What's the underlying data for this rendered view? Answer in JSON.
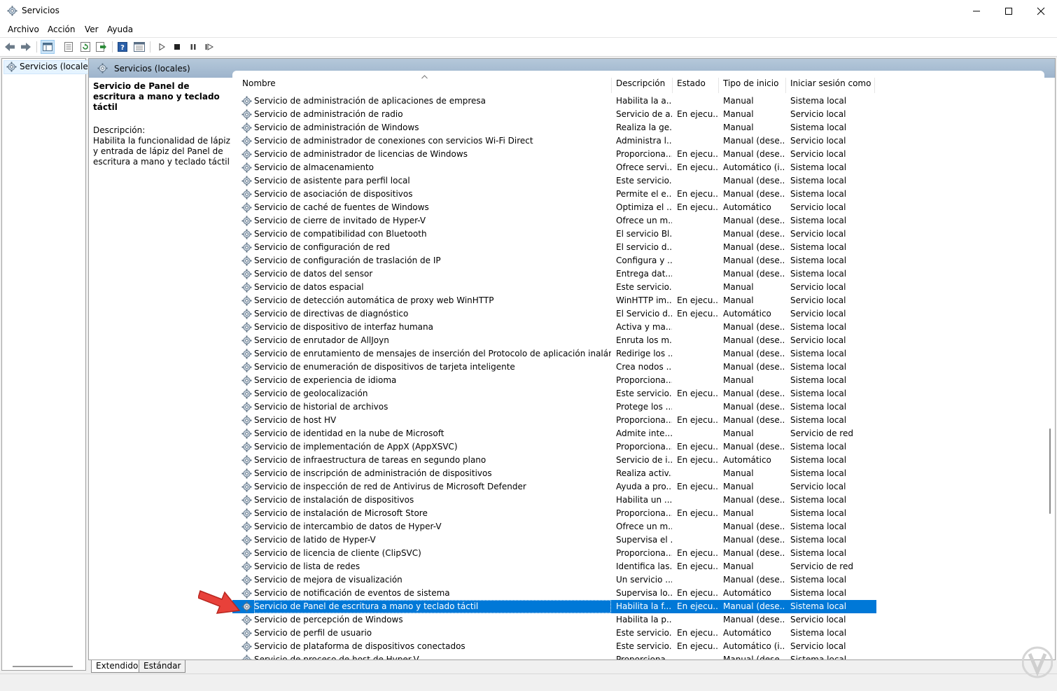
{
  "window": {
    "title": "Servicios",
    "controls": [
      "minimize",
      "maximize",
      "close"
    ]
  },
  "menu": [
    "Archivo",
    "Acción",
    "Ver",
    "Ayuda"
  ],
  "toolbar": {
    "icons": [
      "back-icon",
      "forward-icon",
      "show-tree-icon",
      "properties-icon",
      "refresh-icon",
      "export-icon",
      "help-icon",
      "view-icon",
      "play-icon",
      "stop-icon",
      "pause-icon",
      "restart-icon"
    ]
  },
  "tree": {
    "item": "Servicios (locales)"
  },
  "pane": {
    "header": "Servicios (locales)"
  },
  "description": {
    "title": "Servicio de Panel de escritura a mano y teclado táctil",
    "label": "Descripción:",
    "text": "Habilita la funcionalidad de lápiz y entrada de lápiz del Panel de escritura a mano y teclado táctil"
  },
  "columns": {
    "name": "Nombre",
    "desc": "Descripción",
    "state": "Estado",
    "type": "Tipo de inicio",
    "logon": "Iniciar sesión como"
  },
  "rows": [
    [
      "Servicio de administración de aplicaciones de empresa",
      "Habilita la a...",
      "",
      "Manual",
      "Sistema local"
    ],
    [
      "Servicio de administración de radio",
      "Servicio de a...",
      "En ejecu...",
      "Manual",
      "Servicio local"
    ],
    [
      "Servicio de administración de Windows",
      "Realiza la ge...",
      "",
      "Manual",
      "Sistema local"
    ],
    [
      "Servicio de administrador de conexiones con servicios Wi-Fi Direct",
      "Administra l...",
      "",
      "Manual (dese...",
      "Servicio local"
    ],
    [
      "Servicio de administrador de licencias de Windows",
      "Proporciona...",
      "En ejecu...",
      "Manual (dese...",
      "Servicio local"
    ],
    [
      "Servicio de almacenamiento",
      "Ofrece servi...",
      "En ejecu...",
      "Automático (i...",
      "Sistema local"
    ],
    [
      "Servicio de asistente para perfil local",
      "Este servicio...",
      "",
      "Manual (dese...",
      "Sistema local"
    ],
    [
      "Servicio de asociación de dispositivos",
      "Permite el e...",
      "En ejecu...",
      "Manual (dese...",
      "Sistema local"
    ],
    [
      "Servicio de caché de fuentes de Windows",
      "Optimiza el ...",
      "En ejecu...",
      "Automático",
      "Servicio local"
    ],
    [
      "Servicio de cierre de invitado de Hyper-V",
      "Ofrece un m...",
      "",
      "Manual (dese...",
      "Sistema local"
    ],
    [
      "Servicio de compatibilidad con Bluetooth",
      "El servicio Bl...",
      "",
      "Manual (dese...",
      "Servicio local"
    ],
    [
      "Servicio de configuración de red",
      "El servicio d...",
      "",
      "Manual (dese...",
      "Sistema local"
    ],
    [
      "Servicio de configuración de traslación de IP",
      "Configura y ...",
      "",
      "Manual (dese...",
      "Sistema local"
    ],
    [
      "Servicio de datos del sensor",
      "Entrega dat...",
      "",
      "Manual (dese...",
      "Sistema local"
    ],
    [
      "Servicio de datos espacial",
      "Este servicio...",
      "",
      "Manual",
      "Servicio local"
    ],
    [
      "Servicio de detección automática de proxy web WinHTTP",
      "WinHTTP im...",
      "En ejecu...",
      "Manual",
      "Servicio local"
    ],
    [
      "Servicio de directivas de diagnóstico",
      "El Servicio d...",
      "En ejecu...",
      "Automático",
      "Servicio local"
    ],
    [
      "Servicio de dispositivo de interfaz humana",
      "Activa y ma...",
      "",
      "Manual (dese...",
      "Sistema local"
    ],
    [
      "Servicio de enrutador de AllJoyn",
      "Enruta los m...",
      "",
      "Manual (dese...",
      "Servicio local"
    ],
    [
      "Servicio de enrutamiento de mensajes de inserción del Protocolo de aplicación inalámbrica (W...",
      "Redirige los ...",
      "",
      "Manual (dese...",
      "Sistema local"
    ],
    [
      "Servicio de enumeración de dispositivos de tarjeta inteligente",
      "Crea nodos ...",
      "",
      "Manual (dese...",
      "Sistema local"
    ],
    [
      "Servicio de experiencia de idioma",
      "Proporciona...",
      "",
      "Manual",
      "Sistema local"
    ],
    [
      "Servicio de geolocalización",
      "Este servicio...",
      "En ejecu...",
      "Manual (dese...",
      "Sistema local"
    ],
    [
      "Servicio de historial de archivos",
      "Protege los ...",
      "",
      "Manual (dese...",
      "Sistema local"
    ],
    [
      "Servicio de host HV",
      "Proporciona...",
      "En ejecu...",
      "Manual (dese...",
      "Sistema local"
    ],
    [
      "Servicio de identidad en la nube de Microsoft",
      "Admite inte...",
      "",
      "Manual",
      "Servicio de red"
    ],
    [
      "Servicio de implementación de AppX (AppXSVC)",
      "Proporciona...",
      "En ejecu...",
      "Manual (dese...",
      "Sistema local"
    ],
    [
      "Servicio de infraestructura de tareas en segundo plano",
      "Servicio de i...",
      "En ejecu...",
      "Automático",
      "Sistema local"
    ],
    [
      "Servicio de inscripción de administración de dispositivos",
      "Realiza activ...",
      "",
      "Manual",
      "Sistema local"
    ],
    [
      "Servicio de inspección de red de Antivirus de Microsoft Defender",
      "Ayuda a pro...",
      "En ejecu...",
      "Manual",
      "Servicio local"
    ],
    [
      "Servicio de instalación de dispositivos",
      "Habilita un ...",
      "",
      "Manual (dese...",
      "Sistema local"
    ],
    [
      "Servicio de instalación de Microsoft Store",
      "Proporciona...",
      "En ejecu...",
      "Manual",
      "Sistema local"
    ],
    [
      "Servicio de intercambio de datos de Hyper-V",
      "Ofrece un m...",
      "",
      "Manual (dese...",
      "Sistema local"
    ],
    [
      "Servicio de latido de Hyper-V",
      "Supervisa el ...",
      "",
      "Manual (dese...",
      "Sistema local"
    ],
    [
      "Servicio de licencia de cliente (ClipSVC)",
      "Proporciona...",
      "En ejecu...",
      "Manual (dese...",
      "Sistema local"
    ],
    [
      "Servicio de lista de redes",
      "Identifica las...",
      "En ejecu...",
      "Manual",
      "Servicio de red"
    ],
    [
      "Servicio de mejora de visualización",
      "Un servicio ...",
      "",
      "Manual (dese...",
      "Sistema local"
    ],
    [
      "Servicio de notificación de eventos de sistema",
      "Supervisa lo...",
      "En ejecu...",
      "Automático",
      "Sistema local"
    ],
    [
      "Servicio de Panel de escritura a mano y teclado táctil",
      "Habilita la f...",
      "En ejecu...",
      "Manual (dese...",
      "Sistema local"
    ],
    [
      "Servicio de percepción de Windows",
      "Habilita la p...",
      "",
      "Manual (dese...",
      "Servicio local"
    ],
    [
      "Servicio de perfil de usuario",
      "Este servicio...",
      "En ejecu...",
      "Automático",
      "Sistema local"
    ],
    [
      "Servicio de plataforma de dispositivos conectados",
      "Este servicio...",
      "En ejecu...",
      "Automático (i...",
      "Servicio local"
    ],
    [
      "Servicio de proceso de host de Hyper-V",
      "Proporciona...",
      "",
      "Manual (dese...",
      "Sistema local"
    ]
  ],
  "selected_row": 38,
  "tabs": [
    "Extendido",
    "Estándar"
  ],
  "active_tab": 0,
  "colors": {
    "selection": "#0078d7",
    "header_band": "#a8bed4",
    "annotation_arrow": "#e8413a"
  }
}
